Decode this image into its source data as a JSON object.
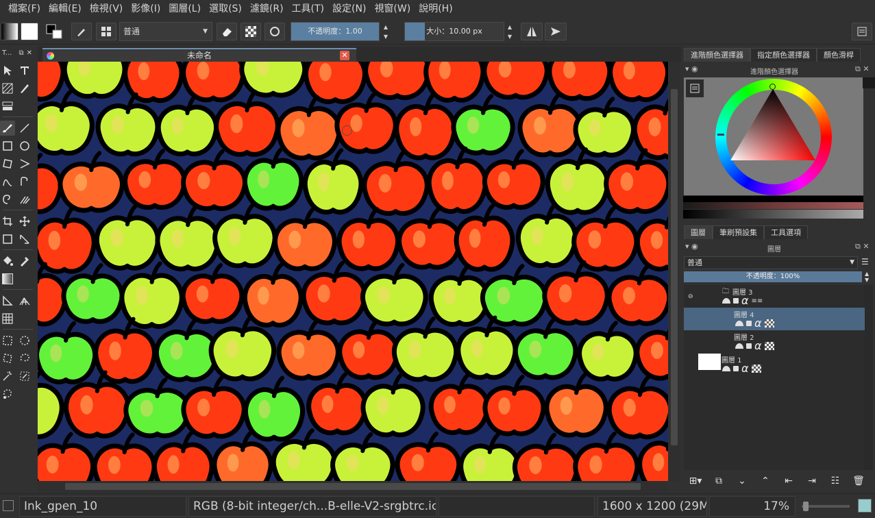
{
  "menu": [
    "檔案(F)",
    "編輯(E)",
    "檢視(V)",
    "影像(I)",
    "圖層(L)",
    "選取(S)",
    "濾鏡(R)",
    "工具(T)",
    "設定(N)",
    "視窗(W)",
    "說明(H)"
  ],
  "tool_options": {
    "blend_mode": "普通",
    "opacity_label": "不透明度：",
    "opacity_value": "1.00",
    "opacity_level": 1.0,
    "size_label": "大小：",
    "size_value": "10.00 px",
    "size_level": 0.2
  },
  "toolbox": {
    "title": "T..."
  },
  "document": {
    "tab_title": "未命名",
    "close_symbol": "✕"
  },
  "dockers": {
    "color_tabs": [
      "進階顏色選擇器",
      "指定顏色選擇器",
      "顏色滑桿"
    ],
    "color_panel_title": "進階顏色選擇器",
    "layer_tabs": [
      "圖層",
      "筆刷預設集",
      "工具選項"
    ],
    "layer_panel_title": "圖層",
    "blend_mode": "普通",
    "opacity_text": "不透明度：100%"
  },
  "layers": [
    {
      "name": "圖層 3",
      "type": "group",
      "selected": false
    },
    {
      "name": "圖層 4",
      "type": "paint",
      "selected": true
    },
    {
      "name": "圖層 2",
      "type": "paint",
      "selected": false
    },
    {
      "name": "圖層 1",
      "type": "paint",
      "selected": false
    }
  ],
  "status": {
    "brush": "Ink_gpen_10",
    "color_profile": "RGB (8-bit integer/ch...B-elle-V2-srgbtrc.icc",
    "dimensions": "1600 x 1200 (29M)",
    "zoom": "17%"
  },
  "colors": {
    "background": "#313131",
    "canvas_bg": "#1c2b63",
    "apple_red": "#ff3a12",
    "apple_green": "#63f23a",
    "apple_yellow": "#c8f23a",
    "accent": "#5a7a9a"
  }
}
